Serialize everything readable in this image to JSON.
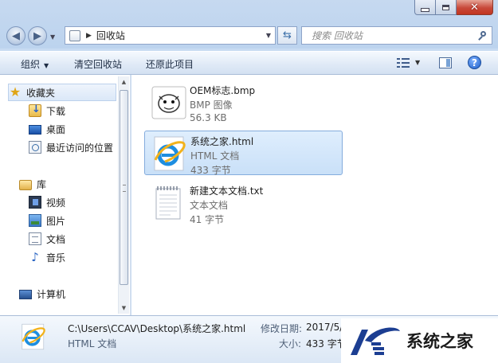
{
  "window": {
    "address_text": "回收站",
    "search_placeholder": "搜索 回收站"
  },
  "toolbar": {
    "organize_label": "组织",
    "empty_label": "清空回收站",
    "restore_label": "还原此项目"
  },
  "sidebar": {
    "favorites": {
      "label": "收藏夹",
      "items": [
        {
          "label": "下载",
          "icon": "download-folder-icon"
        },
        {
          "label": "桌面",
          "icon": "desktop-icon"
        },
        {
          "label": "最近访问的位置",
          "icon": "recent-places-icon"
        }
      ]
    },
    "libraries": {
      "label": "库",
      "items": [
        {
          "label": "视频",
          "icon": "video-icon"
        },
        {
          "label": "图片",
          "icon": "pictures-icon"
        },
        {
          "label": "文档",
          "icon": "documents-icon"
        },
        {
          "label": "音乐",
          "icon": "music-icon"
        }
      ]
    },
    "computer": {
      "label": "计算机"
    }
  },
  "files": [
    {
      "name": "OEM标志.bmp",
      "type": "BMP 图像",
      "size": "56.3 KB",
      "icon": "bmp-image-icon"
    },
    {
      "name": "系统之家.html",
      "type": "HTML 文档",
      "size": "433 字节",
      "icon": "ie-html-icon"
    },
    {
      "name": "新建文本文档.txt",
      "type": "文本文档",
      "size": "41 字节",
      "icon": "text-file-icon"
    }
  ],
  "details": {
    "path": "C:\\Users\\CCAV\\Desktop\\系统之家.html",
    "type": "HTML 文档",
    "modified_label": "修改日期:",
    "modified_value": "2017/5/",
    "size_label": "大小:",
    "size_value": "433 字节"
  },
  "watermark": {
    "text": "系统之家"
  },
  "colors": {
    "selection": "#c9e0f8",
    "accent": "#1f5fc8",
    "close": "#c8493a"
  }
}
